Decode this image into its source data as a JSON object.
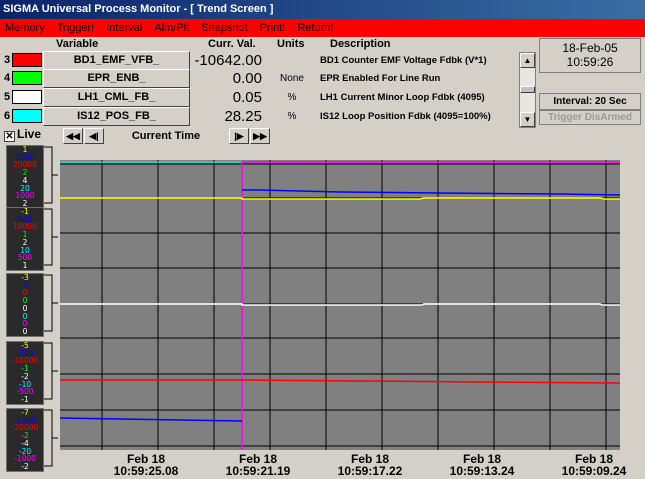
{
  "window": {
    "title": "SIGMA Universal Process Monitor - [ Trend Screen ]"
  },
  "menu": [
    "Memory",
    "Trigger!",
    "Interval",
    "Alm/Plt",
    "Snapshot",
    "Print!",
    "Return!"
  ],
  "headers": {
    "variable": "Variable",
    "curr_val": "Curr. Val.",
    "units": "Units",
    "description": "Description"
  },
  "variables": [
    {
      "num": "3",
      "color": "#ff0000",
      "name": "BD1_EMF_VFB_",
      "value": "-10642.00",
      "units": "",
      "desc": "BD1 Counter EMF Voltage Fdbk (V*1)"
    },
    {
      "num": "4",
      "color": "#00ff00",
      "name": "EPR_ENB_",
      "value": "0.00",
      "units": "None",
      "desc": "EPR Enabled For Line Run"
    },
    {
      "num": "5",
      "color": "#ffffff",
      "name": "LH1_CML_FB_",
      "value": "0.05",
      "units": "%",
      "desc": "LH1 Current Minor Loop Fdbk (4095)"
    },
    {
      "num": "6",
      "color": "#00ffff",
      "name": "IS12_POS_FB_",
      "value": "28.25",
      "units": "%",
      "desc": "IS12 Loop Position Fdbk (4095=100%)"
    }
  ],
  "datetime": {
    "date": "18-Feb-05",
    "time": "10:59:26"
  },
  "interval": "Interval:  20 Sec",
  "trigger": "Trigger DisArmed",
  "live_label": "Live",
  "live_checked": true,
  "current_time_label": "Current Time",
  "scales": [
    [
      "1",
      "1000",
      "20000",
      "2",
      "4",
      "20",
      "1000",
      "2"
    ],
    [
      "-1",
      "500",
      "10000",
      "1",
      "2",
      "10",
      "500",
      "1"
    ],
    [
      "-3",
      "0",
      "0",
      "0",
      "0",
      "0",
      "0",
      "0"
    ],
    [
      "-5",
      "-500",
      "-10000",
      "-1",
      "-2",
      "-10",
      "-500",
      "-1"
    ],
    [
      "-7",
      "-1000",
      "-20000",
      "-2",
      "-4",
      "-20",
      "-1000",
      "-2"
    ]
  ],
  "scale_colors": [
    "#ffff00",
    "#0000ff",
    "#ff0000",
    "#00ff00",
    "#ffffff",
    "#00ffff",
    "#ff00ff",
    "#ffffff"
  ],
  "time_labels": [
    {
      "date": "Feb 18",
      "time": "10:59:25.08"
    },
    {
      "date": "Feb 18",
      "time": "10:59:21.19"
    },
    {
      "date": "Feb 18",
      "time": "10:59:17.22"
    },
    {
      "date": "Feb 18",
      "time": "10:59:13.24"
    },
    {
      "date": "Feb 18",
      "time": "10:59:09.24"
    }
  ]
}
